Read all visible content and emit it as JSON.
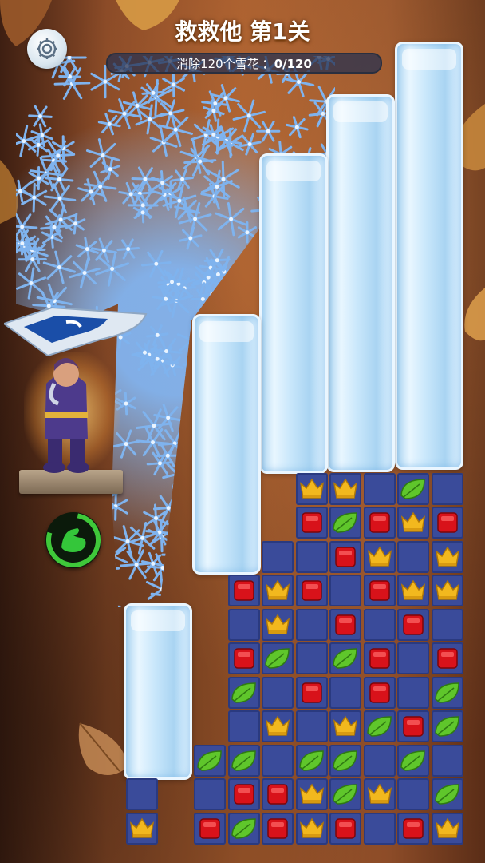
{
  "header": {
    "title": "救救他 第1关",
    "goal_text": "消除120个雪花",
    "goal_count": "：0/120",
    "goal_progress": 0
  },
  "icons": {
    "settings": "gear-icon",
    "power": "muscle-arm-icon",
    "snow": "snowflake-icon"
  },
  "colors": {
    "cell": "#3a4b9a",
    "crown": "#f2b81e",
    "gem": "#d8121a",
    "leaf": "#5fc62b",
    "snow": "#7fb3ee"
  },
  "board": [
    [
      "",
      "",
      "",
      "",
      "",
      "",
      "",
      "",
      "",
      "",
      "",
      "",
      "",
      ""
    ],
    [
      "",
      "",
      "",
      "",
      "",
      "",
      "",
      "",
      "crown",
      "crown",
      "empty",
      "leaf",
      "empty",
      ""
    ],
    [
      "",
      "",
      "",
      "",
      "",
      "",
      "",
      "",
      "gem",
      "leaf",
      "gem",
      "crown",
      "gem",
      ""
    ],
    [
      "",
      "",
      "",
      "",
      "",
      "",
      "",
      "empty",
      "empty",
      "gem",
      "crown",
      "empty",
      "crown",
      ""
    ],
    [
      "",
      "",
      "",
      "",
      "",
      "",
      "gem",
      "crown",
      "gem",
      "empty",
      "gem",
      "crown",
      "crown",
      ""
    ],
    [
      "",
      "",
      "",
      "",
      "",
      "",
      "empty",
      "crown",
      "empty",
      "gem",
      "empty",
      "gem",
      "empty",
      ""
    ],
    [
      "",
      "",
      "",
      "",
      "",
      "",
      "gem",
      "leaf",
      "empty",
      "leaf",
      "gem",
      "empty",
      "gem",
      ""
    ],
    [
      "",
      "",
      "",
      "",
      "",
      "",
      "leaf",
      "empty",
      "gem",
      "empty",
      "gem",
      "empty",
      "leaf",
      ""
    ],
    [
      "",
      "",
      "",
      "",
      "",
      "",
      "empty",
      "crown",
      "empty",
      "crown",
      "leaf",
      "gem",
      "leaf",
      ""
    ],
    [
      "",
      "",
      "",
      "",
      "",
      "leaf",
      "leaf",
      "empty",
      "leaf",
      "leaf",
      "empty",
      "leaf",
      "empty",
      ""
    ],
    [
      "",
      "",
      "",
      "empty",
      "",
      "empty",
      "gem",
      "gem",
      "crown",
      "leaf",
      "crown",
      "empty",
      "leaf",
      ""
    ],
    [
      "",
      "",
      "",
      "crown",
      "",
      "gem",
      "leaf",
      "gem",
      "crown",
      "gem",
      "empty",
      "gem",
      "crown",
      ""
    ]
  ]
}
